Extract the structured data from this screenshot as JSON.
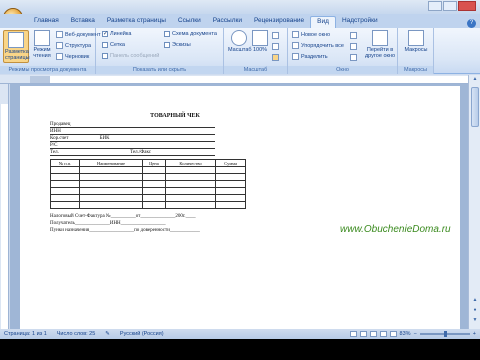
{
  "ribbon_tabs": [
    "Главная",
    "Вставка",
    "Разметка страницы",
    "Ссылки",
    "Рассылки",
    "Рецензирование",
    "Вид",
    "Надстройки"
  ],
  "active_tab": "Вид",
  "groups": {
    "doc_views": {
      "label": "Режимы просмотра документа",
      "page_layout": "Разметка страницы",
      "reading": "Режим чтения",
      "web_document": "Веб-документ",
      "structure": "Структура",
      "draft": "Черновик"
    },
    "show_hide": {
      "label": "Показать или скрыть",
      "ruler": "Линейка",
      "grid": "Сетка",
      "message_bar": "Панель сообщений",
      "doc_map": "Схема документа",
      "thumbnails": "Эскизы"
    },
    "zoom": {
      "label": "Масштаб",
      "zoom": "Масштаб",
      "percent": "100%"
    },
    "window": {
      "label": "Окно",
      "new_window": "Новое окно",
      "arrange_all": "Упорядочить все",
      "split": "Разделить",
      "switch_windows": "Перейти в другое окно"
    },
    "macros": {
      "label": "Макросы",
      "macros": "Макросы"
    }
  },
  "document": {
    "title": "ТОВАРНЫЙ ЧЕК",
    "fields": [
      "Продавец",
      "ИНН",
      "Кор.счет",
      "БИК",
      "Р/С",
      "Тел.",
      "Тел./Факс"
    ],
    "table_headers": [
      "№ п.п.",
      "Наименование",
      "Цена",
      "Количество",
      "Сумма"
    ],
    "empty_rows": 6,
    "footer": [
      "Налоговый Счет-Фактура №",
      "от",
      "200",
      "г.",
      "Получатель",
      "ИНН",
      "Пунки назначения",
      "по доверенности"
    ]
  },
  "status": {
    "page": "Страница: 1 из 1",
    "words": "Число слов: 25",
    "language": "Русский (Россия)",
    "zoom": "83%"
  },
  "watermark": "www.ObuchenieDoma.ru"
}
